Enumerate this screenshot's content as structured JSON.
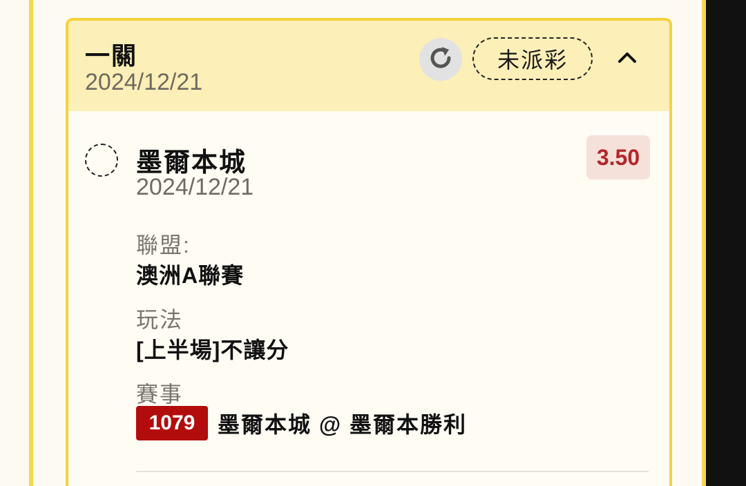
{
  "header": {
    "bet_type": "一關",
    "date": "2024/12/21",
    "status": "未派彩",
    "icons": {
      "refresh": "refresh-icon",
      "collapse": "chevron-up-icon"
    }
  },
  "selection": {
    "team": "墨爾本城",
    "date": "2024/12/21",
    "odds": "3.50",
    "league_label": "聯盟:",
    "league_value": "澳洲A聯賽",
    "play_label": "玩法",
    "play_value": "[上半場]不讓分",
    "match_label": "賽事",
    "match_id": "1079",
    "match_text": "墨爾本城 @ 墨爾本勝利"
  },
  "colors": {
    "accent_yellow": "#f5d23a",
    "header_bg": "#fcefb7",
    "odds_red": "#b3262a",
    "match_id_bg": "#b30c0c"
  }
}
